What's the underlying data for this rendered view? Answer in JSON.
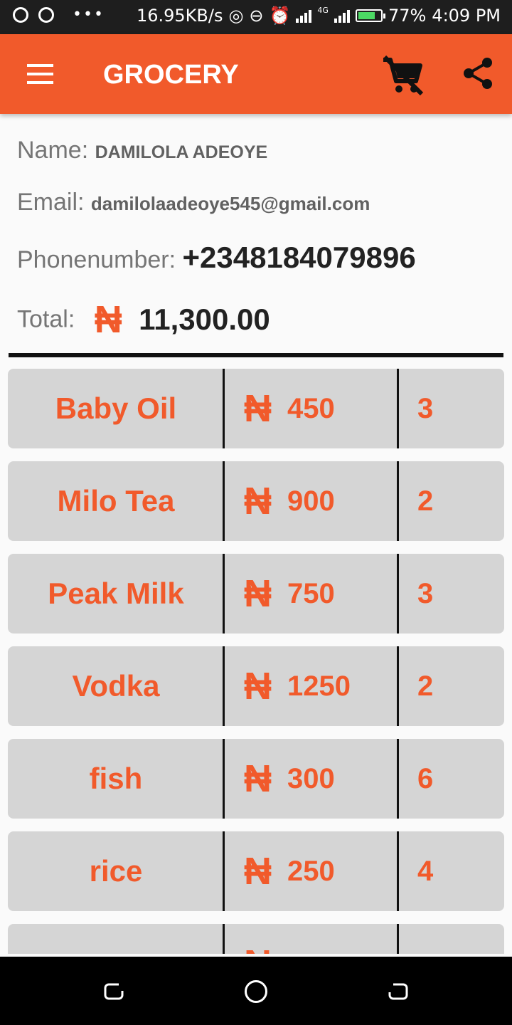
{
  "status_bar": {
    "speed": "16.95KB/s",
    "network": "4G",
    "battery": "77%",
    "battery_level": 0.77,
    "time": "4:09 PM"
  },
  "toolbar": {
    "title": "GROCERY",
    "menu_icon": "hamburger-menu-icon",
    "cart_icon": "remove-shopping-cart-icon",
    "share_icon": "share-icon"
  },
  "user": {
    "name_label": "Name:",
    "name": "DAMILOLA ADEOYE",
    "email_label": "Email:",
    "email": "damilolaadeoye545@gmail.com",
    "phone_label": "Phonenumber:",
    "phone": "+2348184079896",
    "total_label": "Total:",
    "currency": "₦",
    "total": "11,300.00"
  },
  "items": [
    {
      "name": "Baby Oil",
      "currency": "₦",
      "price": "450",
      "qty": "3"
    },
    {
      "name": "Milo Tea",
      "currency": "₦",
      "price": "900",
      "qty": "2"
    },
    {
      "name": "Peak Milk",
      "currency": "₦",
      "price": "750",
      "qty": "3"
    },
    {
      "name": "Vodka",
      "currency": "₦",
      "price": "1250",
      "qty": "2"
    },
    {
      "name": "fish",
      "currency": "₦",
      "price": "300",
      "qty": "6"
    },
    {
      "name": "rice",
      "currency": "₦",
      "price": "250",
      "qty": "4"
    },
    {
      "name": "",
      "currency": "₦",
      "price": "",
      "qty": ""
    }
  ],
  "colors": {
    "accent": "#f15a2b",
    "row_background": "#d5d5d5",
    "status_bar": "#1e1e1e"
  }
}
